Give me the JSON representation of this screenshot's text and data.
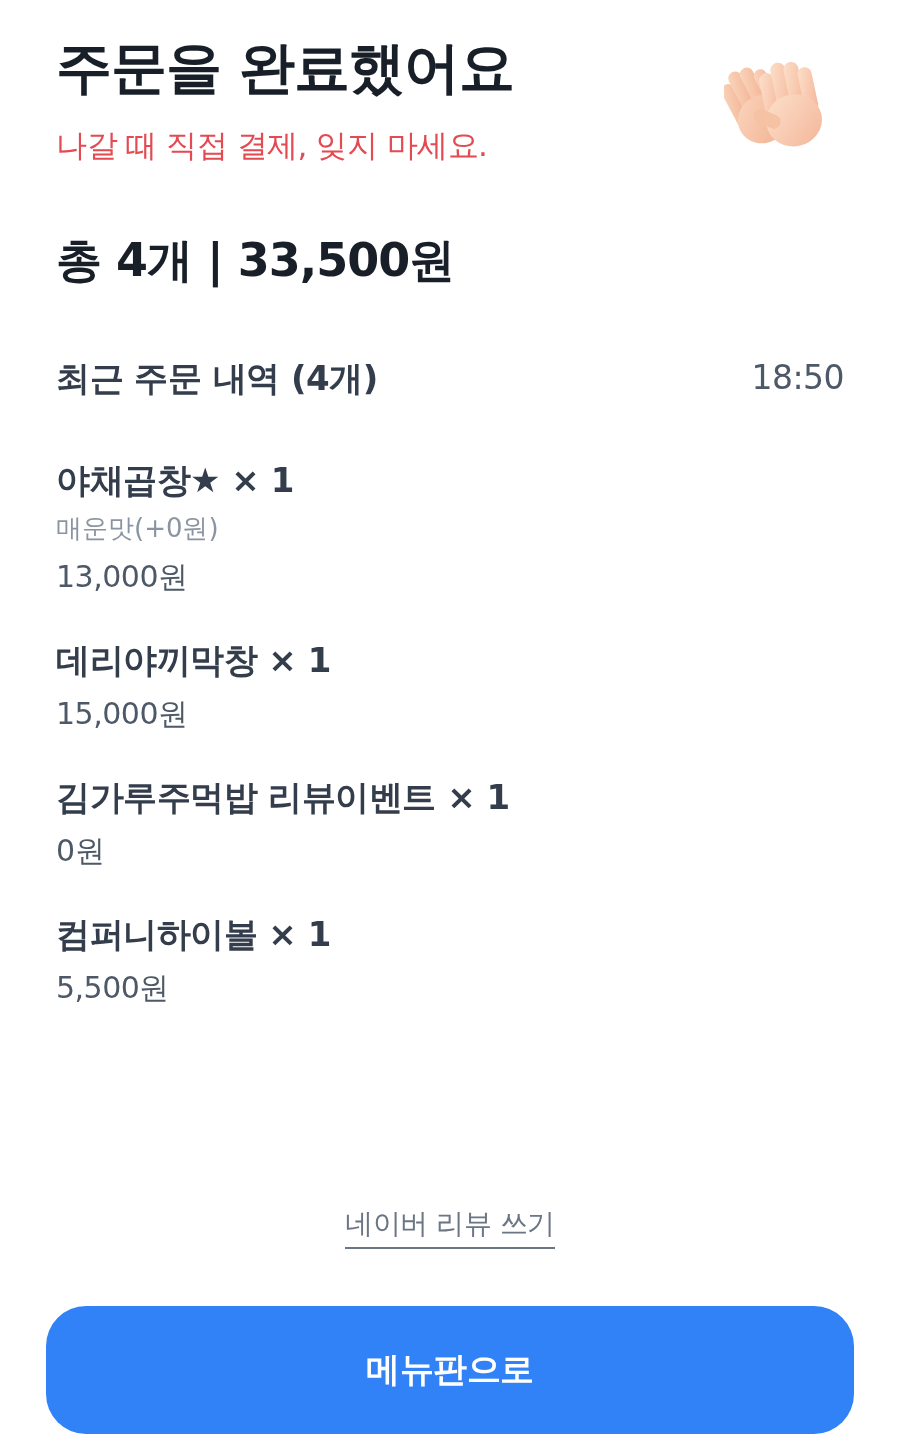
{
  "header": {
    "title": "주문을 완료했어요",
    "notice": "나갈 때 직접 결제, 잊지 마세요."
  },
  "summary": {
    "total": "총 4개 | 33,500원"
  },
  "recent_orders": {
    "heading": "최근 주문 내역 (4개)",
    "time": "18:50",
    "items": [
      {
        "title": "야채곱창★ × 1",
        "option": "매운맛(+0원)",
        "price": "13,000원"
      },
      {
        "title": "데리야끼막창 × 1",
        "price": "15,000원"
      },
      {
        "title": "김가루주먹밥 리뷰이벤트 × 1",
        "price": "0원"
      },
      {
        "title": "컴퍼니하이볼 × 1",
        "price": "5,500원"
      }
    ]
  },
  "review_link": "네이버 리뷰 쓰기",
  "button": "메뉴판으로"
}
